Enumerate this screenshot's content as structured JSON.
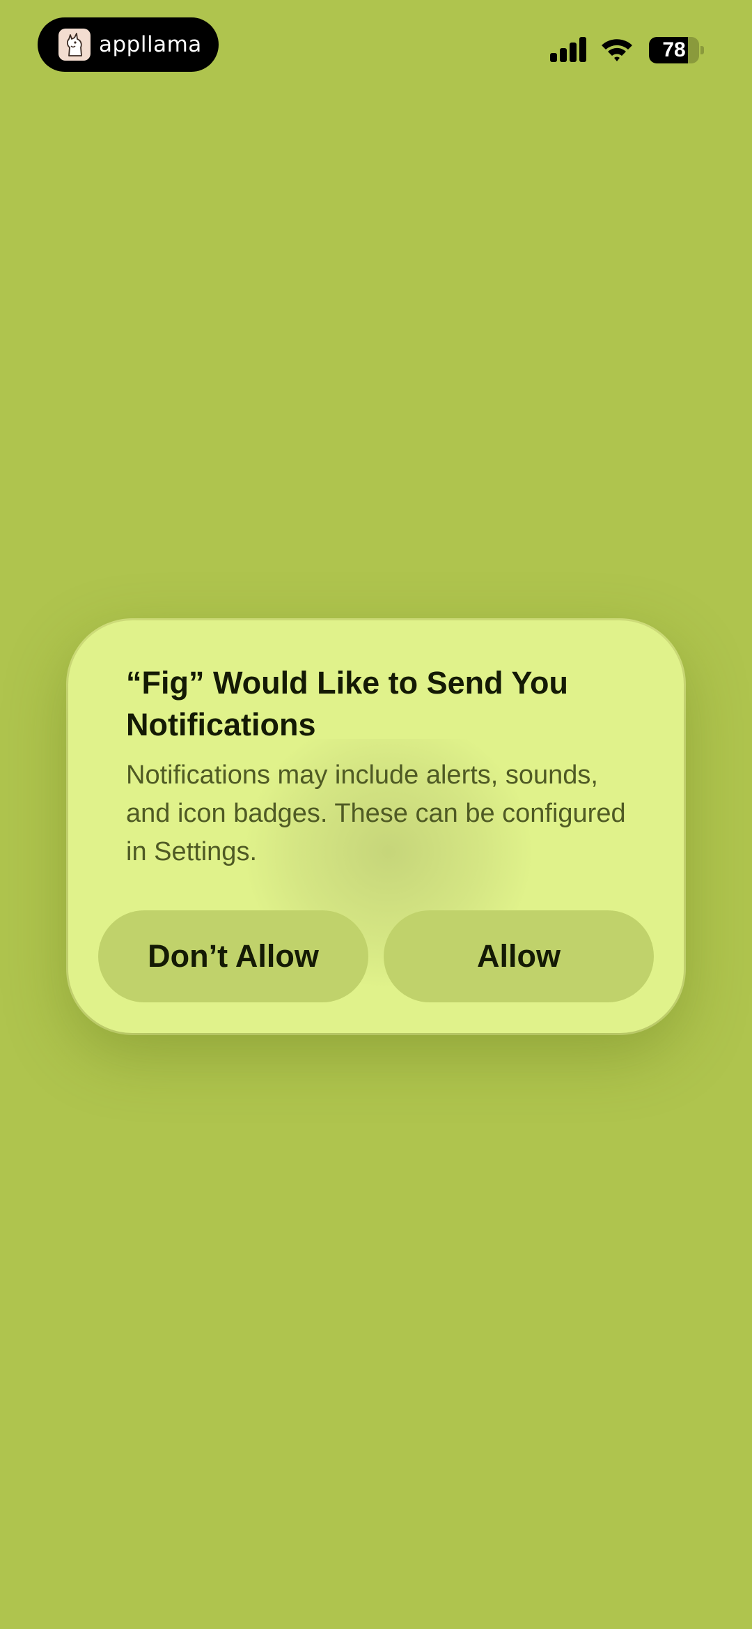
{
  "status_bar": {
    "app_pill": {
      "app_name": "appllama",
      "logo_icon": "llama-logo-icon"
    },
    "signal_icon": "cellular-signal-icon",
    "wifi_icon": "wifi-icon",
    "battery": {
      "level": 78,
      "label": "78"
    }
  },
  "dialog": {
    "title": "“Fig” Would Like to Send You Notifications",
    "message": "Notifications may include alerts, sounds, and icon badges. These can be configured in Settings.",
    "buttons": {
      "deny_label": "Don’t Allow",
      "allow_label": "Allow"
    }
  },
  "colors": {
    "background": "#afc44e",
    "dialog_background": "#e0f28b",
    "button_background": "#c0d26b",
    "title_text": "#141a05",
    "message_text": "#4f5a24"
  }
}
